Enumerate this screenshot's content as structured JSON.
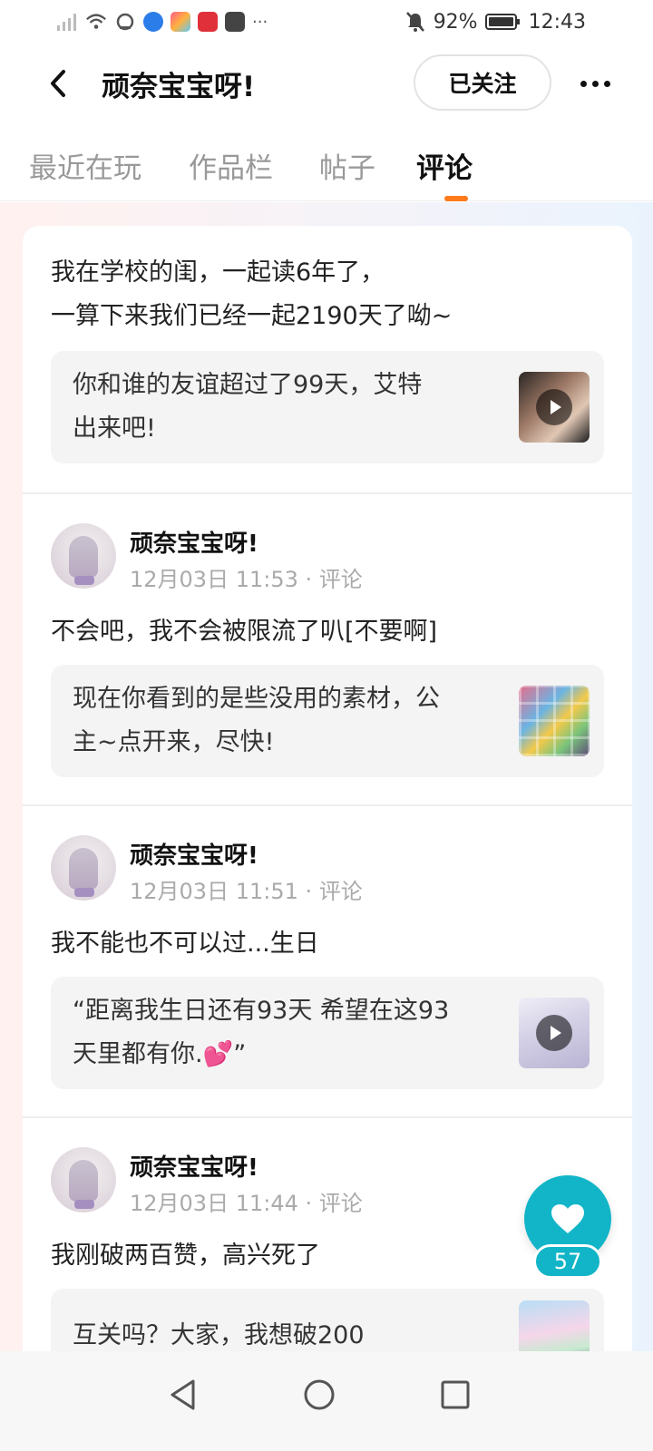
{
  "status_bar": {
    "battery": "92%",
    "time": "12:43",
    "more": "···",
    "icons": [
      "signal-icon",
      "wifi-icon",
      "sync-icon",
      "app-blue-icon",
      "app-multicolor-icon",
      "app-red-book-icon",
      "app-mail-icon",
      "mute-bell-icon",
      "battery-icon"
    ]
  },
  "header": {
    "title": "顽奈宝宝呀!",
    "follow_label": "已关注"
  },
  "tabs": [
    {
      "label": "最近在玩"
    },
    {
      "label": "作品栏"
    },
    {
      "label": "帖子"
    },
    {
      "label": "评论"
    }
  ],
  "active_tab": "评论",
  "cards": [
    {
      "text_lines": [
        "我在学校的闺，一起读6年了，",
        "一算下来我们已经一起2190天了呦~"
      ],
      "quote_lines": [
        "你和谁的友谊超过了99天，艾特",
        "出来吧!"
      ],
      "thumb_type": "video"
    },
    {
      "author": "顽奈宝宝呀!",
      "meta": "12月03日 11:53 · 评论",
      "text": "不会吧，我不会被限流了叭[不要啊]",
      "quote_lines": [
        "现在你看到的是些没用的素材，公",
        "主~点开来，尽快!"
      ],
      "thumb_type": "image"
    },
    {
      "author": "顽奈宝宝呀!",
      "meta": "12月03日 11:51 · 评论",
      "text": "我不能也不可以过...生日",
      "quote_lines": [
        "“距离我生日还有93天 希望在这93",
        "天里都有你."
      ],
      "quote_emoji": "💕",
      "quote_close": "”",
      "thumb_type": "video"
    },
    {
      "author": "顽奈宝宝呀!",
      "meta": "12月03日 11:44 · 评论",
      "text": "我刚破两百赞，高兴死了",
      "quote_lines": [
        "互关吗？大家，我想破200"
      ],
      "thumb_type": "image"
    }
  ],
  "like": {
    "count": "57"
  },
  "colors": {
    "accent_orange": "#ff7a1a",
    "like_teal": "#12b5c7"
  }
}
